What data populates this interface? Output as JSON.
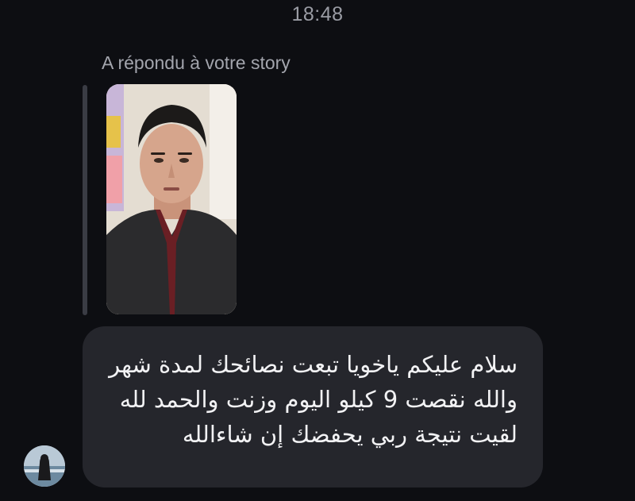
{
  "conversation": {
    "timestamp": "18:48",
    "reply_label": "A répondu à votre story",
    "message": {
      "text": "سلام عليكم ياخويا تبعت نصائحك لمدة شهر والله نقصت 9 كيلو اليوم وزنت والحمد لله لقيت نتيجة ربي يحفضك إن شاءالله"
    }
  },
  "icons": {
    "story": "story-thumbnail",
    "avatar": "sender-avatar"
  },
  "colors": {
    "background": "#0d0e12",
    "bubble": "#25262c",
    "text": "#f2f2f4",
    "muted": "#9a9ca4"
  }
}
